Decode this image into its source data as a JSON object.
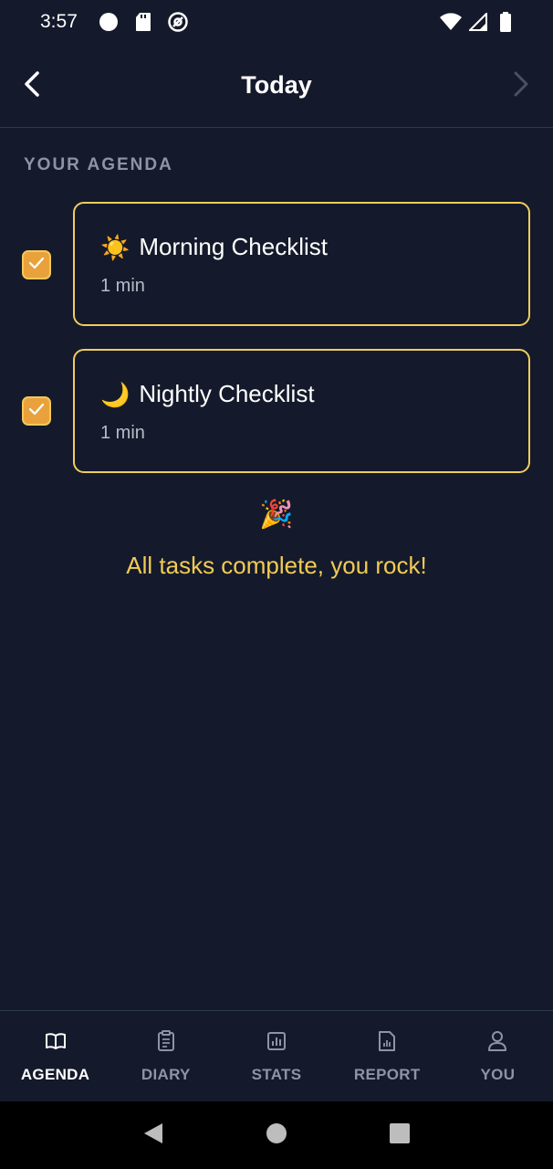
{
  "status_bar": {
    "time": "3:57",
    "left_icons": [
      "circle-icon",
      "sd-card-icon",
      "at-sign-icon"
    ],
    "right_icons": [
      "wifi-icon",
      "signal-icon",
      "battery-icon"
    ]
  },
  "header": {
    "title": "Today",
    "back_icon": "chevron-left-icon",
    "forward_icon": "chevron-right-icon"
  },
  "agenda": {
    "section_label": "YOUR AGENDA",
    "items": [
      {
        "emoji": "☀️",
        "title": "Morning Checklist",
        "duration": "1 min",
        "checked": true
      },
      {
        "emoji": "🌙",
        "title": "Nightly Checklist",
        "duration": "1 min",
        "checked": true
      }
    ],
    "celebration_emoji": "🎉",
    "complete_message": "All tasks complete, you rock!"
  },
  "bottom_nav": {
    "items": [
      {
        "label": "AGENDA",
        "icon": "book-icon",
        "active": true
      },
      {
        "label": "DIARY",
        "icon": "clipboard-icon",
        "active": false
      },
      {
        "label": "STATS",
        "icon": "bar-chart-icon",
        "active": false
      },
      {
        "label": "REPORT",
        "icon": "report-icon",
        "active": false
      },
      {
        "label": "YOU",
        "icon": "person-icon",
        "active": false
      }
    ]
  },
  "colors": {
    "background": "#141a2b",
    "accent": "#f0cd5c",
    "checkbox": "#e9a23b",
    "muted_text": "#8d94a3"
  }
}
